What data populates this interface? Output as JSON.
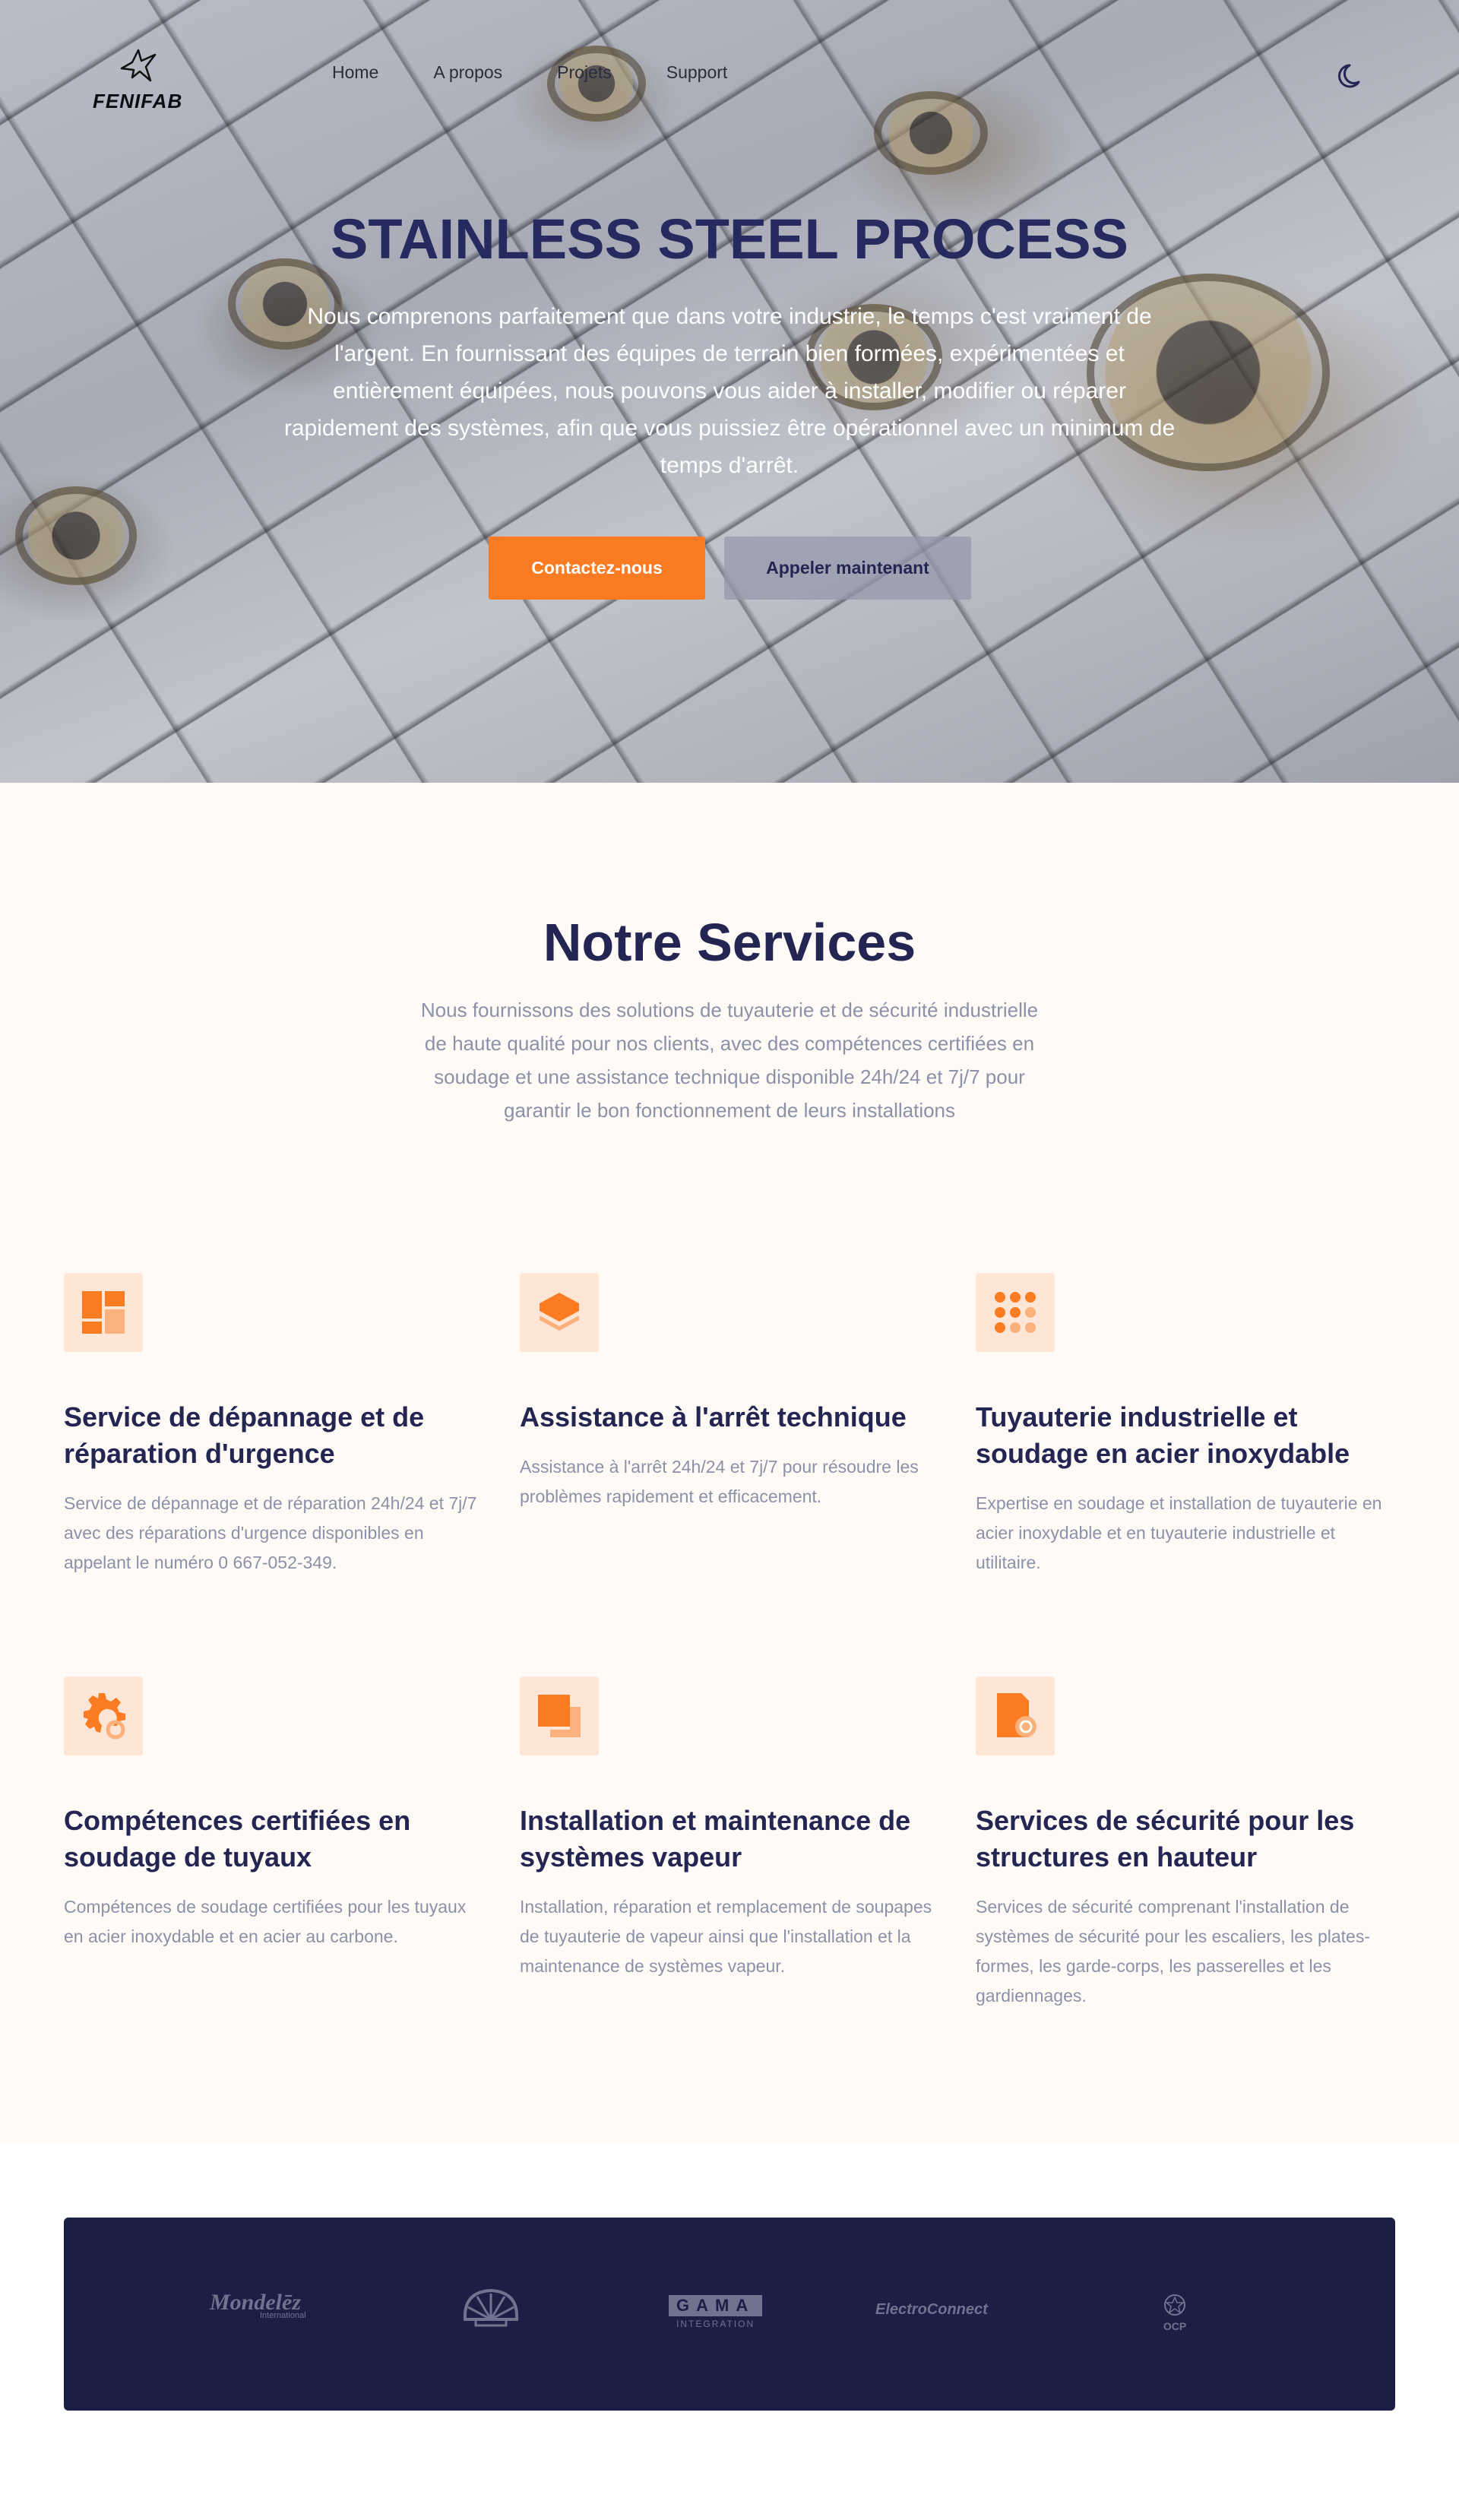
{
  "brand": {
    "name": "FENIFAB"
  },
  "nav": {
    "links": [
      "Home",
      "A propos",
      "Projets",
      "Support"
    ],
    "theme_toggle_icon": "moon-icon"
  },
  "hero": {
    "title": "STAINLESS STEEL PROCESS",
    "description": "Nous comprenons parfaitement que dans votre industrie, le temps c'est vraiment de l'argent. En fournissant des équipes de terrain bien formées, expérimentées et entièrement équipées, nous pouvons vous aider à installer, modifier ou réparer rapidement des systèmes, afin que vous puissiez être opérationnel avec un minimum de temps d'arrêt.",
    "primary_button": "Contactez-nous",
    "secondary_button": "Appeler maintenant"
  },
  "services": {
    "title": "Notre Services",
    "intro": "Nous fournissons des solutions de tuyauterie et de sécurité industrielle de haute qualité pour nos clients, avec des compétences certifiées en soudage et une assistance technique disponible 24h/24 et 7j/7 pour garantir le bon fonctionnement de leurs installations",
    "items": [
      {
        "icon": "dashboard-icon",
        "title": "Service de dépannage et de réparation d'urgence",
        "description": "Service de dépannage et de réparation 24h/24 et 7j/7 avec des réparations d'urgence disponibles en appelant le numéro 0 667-052-349."
      },
      {
        "icon": "layers-icon",
        "title": "Assistance à l'arrêt technique",
        "description": "Assistance à l'arrêt 24h/24 et 7j/7 pour résoudre les problèmes rapidement et efficacement."
      },
      {
        "icon": "dots-grid-icon",
        "title": "Tuyauterie industrielle et soudage en acier inoxydable",
        "description": "Expertise en soudage et installation de tuyauterie en acier inoxydable et en tuyauterie industrielle et utilitaire."
      },
      {
        "icon": "gear-refresh-icon",
        "title": "Compétences certifiées en soudage de tuyaux",
        "description": "Compétences de soudage certifiées pour les tuyaux en acier inoxydable et en acier au carbone."
      },
      {
        "icon": "squares-icon",
        "title": "Installation et maintenance de systèmes vapeur",
        "description": "Installation, réparation et remplacement de soupapes de tuyauterie de vapeur ainsi que l'installation et la maintenance de systèmes vapeur."
      },
      {
        "icon": "document-refresh-icon",
        "title": "Services de sécurité pour les structures en hauteur",
        "description": "Services de sécurité comprenant l'installation de systèmes de sécurité pour les escaliers, les plates-formes, les garde-corps, les passerelles et les gardiennages."
      }
    ]
  },
  "partners": {
    "logos": [
      {
        "name": "Mondelēz",
        "sub": "International"
      },
      {
        "name": "shell-logo"
      },
      {
        "name": "GAMA",
        "sub": "INTEGRATION"
      },
      {
        "name": "ElectroConnect"
      },
      {
        "name": "OCP"
      }
    ]
  },
  "colors": {
    "accent": "#fa7b22",
    "navy": "#232552",
    "panel": "#1c1f45",
    "cream": "#fffaf5",
    "muted": "#8a91a8"
  }
}
